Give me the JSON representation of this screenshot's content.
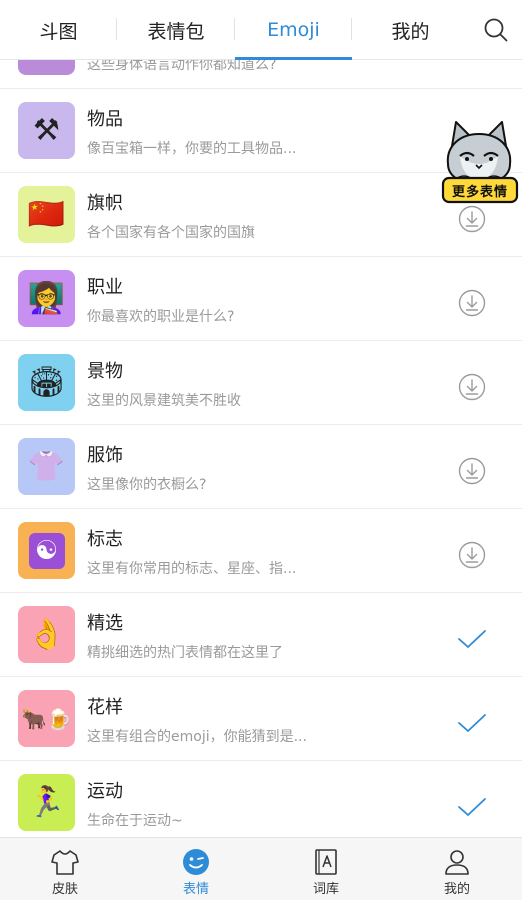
{
  "tabs": [
    "斗图",
    "表情包",
    "Emoji",
    "我的"
  ],
  "active_tab": "Emoji",
  "accent_color": "#2e8bd8",
  "partial_row": {
    "desc": "这些身体语言动作你都知道么?"
  },
  "rows": [
    {
      "title": "物品",
      "desc": "像百宝箱一样，你要的工具物品...",
      "emoji": "⚒",
      "bg": "#c9b8ee",
      "status": "download"
    },
    {
      "title": "旗帜",
      "desc": "各个国家有各个国家的国旗",
      "emoji": "🇨🇳",
      "bg": "#e4f39a",
      "status": "download"
    },
    {
      "title": "职业",
      "desc": "你最喜欢的职业是什么?",
      "emoji": "👩‍🏫",
      "bg": "#c78ff0",
      "status": "download"
    },
    {
      "title": "景物",
      "desc": "这里的风景建筑美不胜收",
      "emoji": "🏟",
      "bg": "#7fd1ef",
      "status": "download"
    },
    {
      "title": "服饰",
      "desc": "这里像你的衣橱么?",
      "emoji": "👚",
      "bg": "#b8c8f6",
      "status": "download"
    },
    {
      "title": "标志",
      "desc": "这里有你常用的标志、星座、指...",
      "emoji": "☯",
      "bg": "#f8b253",
      "status": "download"
    },
    {
      "title": "精选",
      "desc": "精挑细选的热门表情都在这里了",
      "emoji": "👌",
      "bg": "#f9a3b5",
      "status": "done"
    },
    {
      "title": "花样",
      "desc": "这里有组合的emoji，你能猜到是...",
      "emoji": "🐂🍺",
      "bg": "#f9a3b5",
      "status": "done"
    },
    {
      "title": "运动",
      "desc": "生命在于运动~",
      "emoji": "🏃‍♀️",
      "bg": "#c9ee53",
      "status": "done"
    }
  ],
  "mascot_label": "更多表情",
  "bottom_nav": [
    {
      "label": "皮肤",
      "icon": "shirt-icon"
    },
    {
      "label": "表情",
      "icon": "smile-icon"
    },
    {
      "label": "词库",
      "icon": "dictionary-icon"
    },
    {
      "label": "我的",
      "icon": "user-icon"
    }
  ],
  "active_nav": "表情"
}
